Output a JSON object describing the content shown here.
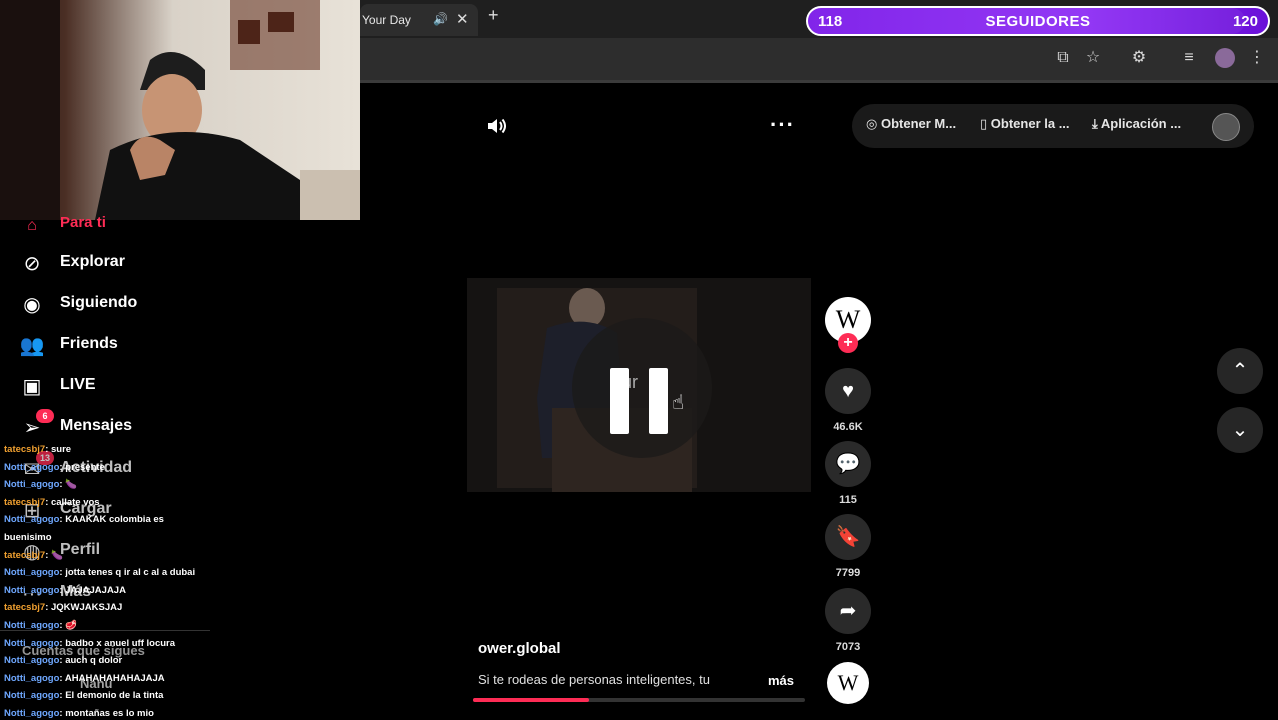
{
  "browser": {
    "tab_title": "Your Day",
    "tab_sound_icon": "speaker-icon",
    "tab_close": "✕",
    "new_tab": "+"
  },
  "followers": {
    "current": "118",
    "label": "SEGUIDORES",
    "goal": "120",
    "progress": 0.95
  },
  "sidebar": {
    "partial_item": "Para ti",
    "items": [
      {
        "label": "Explorar",
        "icon": "compass-icon"
      },
      {
        "label": "Siguiendo",
        "icon": "following-avatar-icon"
      },
      {
        "label": "Friends",
        "icon": "friends-icon"
      },
      {
        "label": "LIVE",
        "icon": "live-tv-icon"
      },
      {
        "label": "Mensajes",
        "icon": "send-icon",
        "badge": "6"
      },
      {
        "label": "Actividad",
        "icon": "inbox-icon",
        "badge": "13"
      },
      {
        "label": "Cargar",
        "icon": "upload-icon"
      },
      {
        "label": "Perfil",
        "icon": "profile-icon"
      },
      {
        "label": "Más",
        "icon": "more-icon"
      }
    ],
    "following_header": "Cuentas que sigues",
    "following_first": "Nanu"
  },
  "chat": [
    {
      "user": "tatecsbj7",
      "msg": ": sure",
      "kind": 2
    },
    {
      "user": "Notti_agogo",
      "msg": ": presente",
      "kind": 1
    },
    {
      "user": "Notti_agogo",
      "msg": ": 🍆",
      "kind": 1
    },
    {
      "user": "tatecsbj7",
      "msg": ": callate vos",
      "kind": 2
    },
    {
      "user": "Notti_agogo",
      "msg": ": KAAKAK colombia es",
      "kind": 1
    },
    {
      "user": "",
      "msg": "buenisimo",
      "kind": 0
    },
    {
      "user": "tatecsbj7",
      "msg": ": 🍆",
      "kind": 2
    },
    {
      "user": "Notti_agogo",
      "msg": ": jotta tenes q ir al c al a dubai",
      "kind": 1
    },
    {
      "user": "Notti_agogo",
      "msg": ": JAJAJAJAJA",
      "kind": 1
    },
    {
      "user": "tatecsbj7",
      "msg": ": JQKWJAKSJAJ",
      "kind": 2
    },
    {
      "user": "Notti_agogo",
      "msg": ": 🥩",
      "kind": 1
    },
    {
      "user": "Notti_agogo",
      "msg": ": badbo x anuel uff locura",
      "kind": 1
    },
    {
      "user": "Notti_agogo",
      "msg": ": auch q dolor",
      "kind": 1
    },
    {
      "user": "Notti_agogo",
      "msg": ": AHAHAHAHAHAJAJA",
      "kind": 1
    },
    {
      "user": "Notti_agogo",
      "msg": ": El demonio de la tinta",
      "kind": 1
    },
    {
      "user": "Notti_agogo",
      "msg": ": montañas es lo mio",
      "kind": 1
    }
  ],
  "top_controls": {
    "volume_icon": "volume-icon",
    "more_icon": "more-horizontal-icon",
    "pills": [
      {
        "label": "Obtener M...",
        "icon": "coin-icon"
      },
      {
        "label": "Obtener la ...",
        "icon": "phone-icon"
      },
      {
        "label": "Aplicación ...",
        "icon": "download-icon"
      }
    ]
  },
  "video": {
    "author": "ower.global",
    "caption": "Si te rodeas de personas inteligentes, tu",
    "more_link": "más",
    "progress": 0.35
  },
  "actions": {
    "likes": "46.6K",
    "comments": "115",
    "saves": "7799",
    "shares": "7073"
  },
  "nav_buttons": {
    "up_icon": "chevron-up-icon",
    "down_icon": "chevron-down-icon"
  }
}
